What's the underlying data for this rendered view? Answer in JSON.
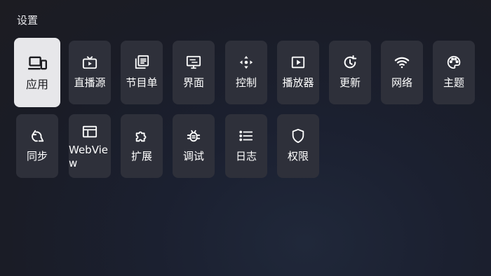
{
  "header": {
    "title": "设置"
  },
  "tiles": [
    {
      "label": "应用",
      "icon": "devices-icon",
      "selected": true
    },
    {
      "label": "直播源",
      "icon": "tv-icon"
    },
    {
      "label": "节目单",
      "icon": "library-books-icon"
    },
    {
      "label": "界面",
      "icon": "display-settings-icon"
    },
    {
      "label": "控制",
      "icon": "dpad-icon"
    },
    {
      "label": "播放器",
      "icon": "play-box-icon"
    },
    {
      "label": "更新",
      "icon": "update-icon"
    },
    {
      "label": "网络",
      "icon": "wifi-icon"
    },
    {
      "label": "主题",
      "icon": "palette-icon"
    },
    {
      "label": "同步",
      "icon": "sync-icon"
    },
    {
      "label_line1": "WebVie",
      "label_line2": "w",
      "icon": "web-icon"
    },
    {
      "label": "扩展",
      "icon": "extension-icon"
    },
    {
      "label": "调试",
      "icon": "bug-icon"
    },
    {
      "label": "日志",
      "icon": "list-icon"
    },
    {
      "label": "权限",
      "icon": "shield-icon"
    }
  ],
  "colors": {
    "tile_bg": "#2e303a",
    "selected_bg": "#e7e7ea",
    "text": "#ffffff"
  }
}
